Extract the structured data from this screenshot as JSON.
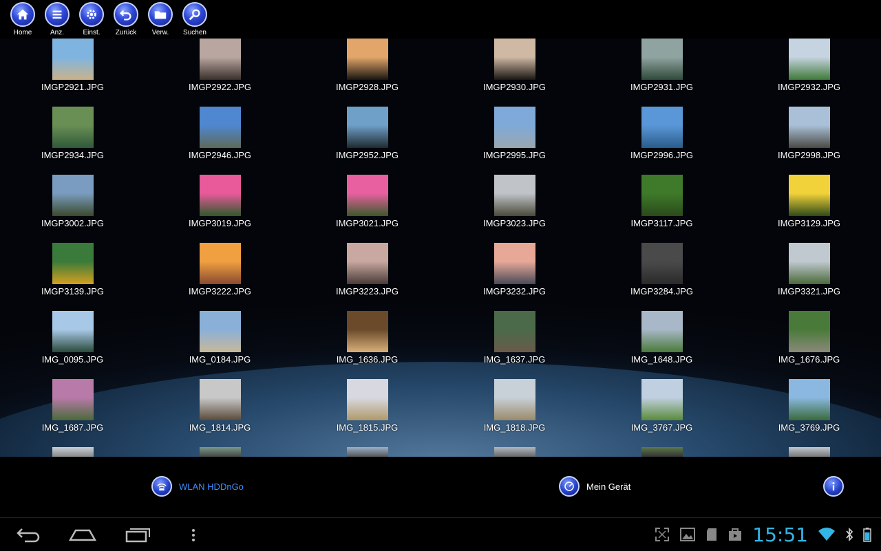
{
  "toolbar": {
    "items": [
      {
        "label": "Home",
        "icon": "home-icon"
      },
      {
        "label": "Anz.",
        "icon": "menu-icon"
      },
      {
        "label": "Einst.",
        "icon": "gear-icon"
      },
      {
        "label": "Zurück",
        "icon": "back-arrow-icon"
      },
      {
        "label": "Verw.",
        "icon": "folder-icon"
      },
      {
        "label": "Suchen",
        "icon": "search-icon"
      }
    ]
  },
  "files": [
    {
      "name": "IMGP2921.JPG",
      "colors": [
        "#7fb4e0",
        "#c9b38a"
      ]
    },
    {
      "name": "IMGP2922.JPG",
      "colors": [
        "#b9a6a0",
        "#3a302c"
      ]
    },
    {
      "name": "IMGP2928.JPG",
      "colors": [
        "#e2a66a",
        "#1a1512"
      ]
    },
    {
      "name": "IMGP2930.JPG",
      "colors": [
        "#cfb8a4",
        "#1a1714"
      ]
    },
    {
      "name": "IMGP2931.JPG",
      "colors": [
        "#8fa3a0",
        "#2f4a3a"
      ]
    },
    {
      "name": "IMGP2932.JPG",
      "colors": [
        "#c6d3e0",
        "#3f7a3a"
      ]
    },
    {
      "name": "IMGP2934.JPG",
      "colors": [
        "#6a8f55",
        "#2f5a3a"
      ]
    },
    {
      "name": "IMGP2946.JPG",
      "colors": [
        "#4f87d0",
        "#5e6a58"
      ]
    },
    {
      "name": "IMGP2952.JPG",
      "colors": [
        "#6ea0c8",
        "#1f2a30"
      ]
    },
    {
      "name": "IMGP2995.JPG",
      "colors": [
        "#7fa9d8",
        "#9aa8b0"
      ]
    },
    {
      "name": "IMGP2996.JPG",
      "colors": [
        "#5a97d8",
        "#2a5c8a"
      ]
    },
    {
      "name": "IMGP2998.JPG",
      "colors": [
        "#a9c0d8",
        "#4a4a44"
      ]
    },
    {
      "name": "IMGP3002.JPG",
      "colors": [
        "#7a9cc0",
        "#3a4a2c"
      ]
    },
    {
      "name": "IMGP3019.JPG",
      "colors": [
        "#e85a9a",
        "#2f5a2a"
      ]
    },
    {
      "name": "IMGP3021.JPG",
      "colors": [
        "#e8609f",
        "#3a5a2a"
      ]
    },
    {
      "name": "IMGP3023.JPG",
      "colors": [
        "#c0c4c8",
        "#4a4a3a"
      ]
    },
    {
      "name": "IMGP3117.JPG",
      "colors": [
        "#3f7a2a",
        "#2a4a1a"
      ]
    },
    {
      "name": "IMGP3129.JPG",
      "colors": [
        "#f2d23a",
        "#2f4a1a"
      ]
    },
    {
      "name": "IMGP3139.JPG",
      "colors": [
        "#3a7a3a",
        "#d4a020"
      ]
    },
    {
      "name": "IMGP3222.JPG",
      "colors": [
        "#f0a040",
        "#8a4a30"
      ]
    },
    {
      "name": "IMGP3223.JPG",
      "colors": [
        "#c8a8a0",
        "#4a3a38"
      ]
    },
    {
      "name": "IMGP3232.JPG",
      "colors": [
        "#e8a898",
        "#4a4a58"
      ]
    },
    {
      "name": "IMGP3284.JPG",
      "colors": [
        "#4a4a4a",
        "#2a2a2a"
      ]
    },
    {
      "name": "IMGP3321.JPG",
      "colors": [
        "#c0c8d0",
        "#4a6a3a"
      ]
    },
    {
      "name": "IMG_0095.JPG",
      "colors": [
        "#a8c8e8",
        "#2a4a3a"
      ]
    },
    {
      "name": "IMG_0184.JPG",
      "colors": [
        "#8ab0d8",
        "#c8b898"
      ]
    },
    {
      "name": "IMG_1636.JPG",
      "colors": [
        "#6a4a2a",
        "#d8b07a"
      ]
    },
    {
      "name": "IMG_1637.JPG",
      "colors": [
        "#4a6a4a",
        "#6a5a4a"
      ]
    },
    {
      "name": "IMG_1648.JPG",
      "colors": [
        "#a8b8c8",
        "#4a7a3a"
      ]
    },
    {
      "name": "IMG_1676.JPG",
      "colors": [
        "#4a7a3a",
        "#8a8a7a"
      ]
    },
    {
      "name": "IMG_1687.JPG",
      "colors": [
        "#b87aa8",
        "#4a6a3a"
      ]
    },
    {
      "name": "IMG_1814.JPG",
      "colors": [
        "#c8c8c8",
        "#5a4a3a"
      ]
    },
    {
      "name": "IMG_1815.JPG",
      "colors": [
        "#d8d8e0",
        "#b09a6a"
      ]
    },
    {
      "name": "IMG_1818.JPG",
      "colors": [
        "#c8d0d8",
        "#9a8a6a"
      ]
    },
    {
      "name": "IMG_3767.JPG",
      "colors": [
        "#c0d0e0",
        "#5a8a3a"
      ]
    },
    {
      "name": "IMG_3769.JPG",
      "colors": [
        "#8ab8e0",
        "#3a6a3a"
      ]
    }
  ],
  "partial_colors": [
    [
      "#c8d0d8",
      "#888"
    ],
    [
      "#7a9a8a",
      "#444"
    ],
    [
      "#9ab0c8",
      "#555"
    ],
    [
      "#b0b8c0",
      "#666"
    ],
    [
      "#5a7a4a",
      "#333"
    ],
    [
      "#c0c8d0",
      "#777"
    ]
  ],
  "footer": {
    "wlan_label": "WLAN HDDnGo",
    "device_label": "Mein Gerät"
  },
  "status": {
    "time": "15:51"
  },
  "colors": {
    "accent_blue": "#33b5e5",
    "link_blue": "#3d8dff"
  }
}
